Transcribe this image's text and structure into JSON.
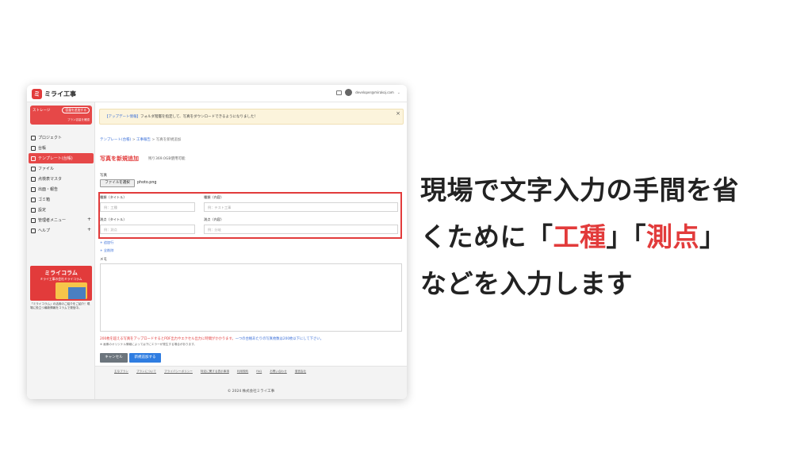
{
  "app": {
    "logo_text": "ミライ工事",
    "user_email": "developer@mirakoj.com"
  },
  "sidebar": {
    "storage_label": "ストレージ",
    "storage_upgrade": "容量を追加する",
    "storage_note": "プラン容量を確認",
    "items": [
      {
        "label": "プロジェクト",
        "icon": "folder-icon",
        "plus": ""
      },
      {
        "label": "台帳",
        "icon": "ledger-icon",
        "plus": ""
      },
      {
        "label": "テンプレート(台帳)",
        "icon": "template-icon",
        "plus": ""
      },
      {
        "label": "ファイル",
        "icon": "file-icon",
        "plus": ""
      },
      {
        "label": "点検表マスタ",
        "icon": "checklist-icon",
        "plus": ""
      },
      {
        "label": "出面・報告",
        "icon": "report-icon",
        "plus": ""
      },
      {
        "label": "ゴミ箱",
        "icon": "trash-icon",
        "plus": ""
      },
      {
        "label": "設定",
        "icon": "gear-icon",
        "plus": ""
      },
      {
        "label": "管理者メニュー",
        "icon": "admin-icon",
        "plus": "+"
      },
      {
        "label": "ヘルプ",
        "icon": "help-icon",
        "plus": "+"
      }
    ],
    "active_index": 2,
    "banner_title": "ミライコラム",
    "banner_sub": "ミライ工事の会社ミライコラム",
    "banner_desc": "「ミライコラム」の活用のご紹介をご紹介！現場に役立つ最新情報をコラムで発信中。"
  },
  "notice": {
    "tag": "【アップデート情報】",
    "text": "フォルダ階層を指定して、写真をダウンロードできるようになりました！",
    "close": "×"
  },
  "breadcrumb": {
    "link1": "テンプレート(台帳)",
    "sep": ">",
    "link2": "工事報告",
    "current": "写真を新規追加"
  },
  "page": {
    "title": "写真を新規追加",
    "quota": "残り369.0GB使用可能",
    "photo_label": "写真",
    "file_button": "ファイルを選択",
    "file_name": "photo.png"
  },
  "fields": [
    {
      "label": "種類（タイトル）",
      "placeholder": "例：工種"
    },
    {
      "label": "種類（内容）",
      "placeholder": "例：テスト工事"
    },
    {
      "label": "測点（タイトル）",
      "placeholder": "例：測点"
    },
    {
      "label": "測点（内容）",
      "placeholder": "例：分岐"
    }
  ],
  "actions": {
    "add_row": "+ 追加行",
    "add_all": "+ 全削除",
    "memo_label": "メモ",
    "warning": "200枚を超える写真をアップロードするとPDF出力やエクセル出力に時間がかかります。",
    "warning_blue": "一つの台帳あたりの写真枚数は200枚以下にして下さい。",
    "small_note": "※ 画像のオリジナル情報によっては下にエラーが発生する場合があります。",
    "cancel": "キャンセル",
    "submit": "新規追加する"
  },
  "footer": {
    "links": [
      "主なプラン",
      "プランについて",
      "プライバシーポリシー",
      "特定に関する表示事項",
      "利用規約",
      "FAQ",
      "お問い合わせ",
      "運営会社"
    ],
    "copyright": "© 2024 株式会社ミライ工事"
  },
  "caption": {
    "line1": "現場で文字入力の手間を省",
    "line2_a": "くために「",
    "line2_red1": "工種",
    "line2_b": "」「",
    "line2_red2": "測点",
    "line2_c": "」",
    "line3": "などを入力します"
  },
  "colors": {
    "accent": "#e23b3b",
    "link": "#3a6fd8",
    "submit": "#2f7de1"
  }
}
